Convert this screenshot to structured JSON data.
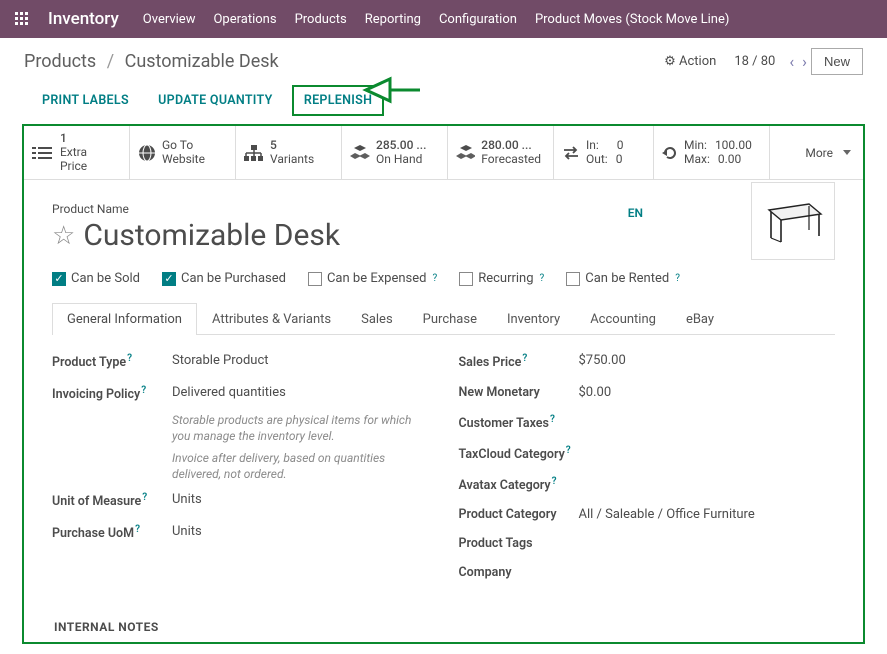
{
  "topnav": {
    "brand": "Inventory",
    "items": [
      "Overview",
      "Operations",
      "Products",
      "Reporting",
      "Configuration",
      "Product Moves (Stock Move Line)"
    ]
  },
  "subhead": {
    "root": "Products",
    "current": "Customizable Desk",
    "action": "Action",
    "pager": "18 / 80",
    "new_btn": "New"
  },
  "hdr_buttons": {
    "print": "PRINT LABELS",
    "update": "UPDATE QUANTITY",
    "replenish": "REPLENISH"
  },
  "stats": {
    "extra_price": {
      "num": "1",
      "label": "Extra Price"
    },
    "website": {
      "l1": "Go To",
      "l2": "Website"
    },
    "variants": {
      "num": "5",
      "label": "Variants"
    },
    "onhand": {
      "num": "285.00 ...",
      "label": "On Hand"
    },
    "forecast": {
      "num": "280.00 ...",
      "label": "Forecasted"
    },
    "inout": {
      "in_l": "In:",
      "in_v": "0",
      "out_l": "Out:",
      "out_v": "0"
    },
    "minmax": {
      "min_l": "Min:",
      "min_v": "100.00",
      "max_l": "Max:",
      "max_v": "0.00"
    },
    "more": "More"
  },
  "form": {
    "pname_label": "Product Name",
    "pname": "Customizable Desk",
    "lang": "EN",
    "checks": {
      "sold": "Can be Sold",
      "purchased": "Can be Purchased",
      "expensed": "Can be Expensed",
      "recurring": "Recurring",
      "rented": "Can be Rented"
    },
    "tabs": [
      "General Information",
      "Attributes & Variants",
      "Sales",
      "Purchase",
      "Inventory",
      "Accounting",
      "eBay"
    ],
    "left": {
      "ptype_l": "Product Type",
      "ptype_v": "Storable Product",
      "inv_l": "Invoicing Policy",
      "inv_v": "Delivered quantities",
      "hint1": "Storable products are physical items for which you manage the inventory level.",
      "hint2": "Invoice after delivery, based on quantities delivered, not ordered.",
      "uom_l": "Unit of Measure",
      "uom_v": "Units",
      "puom_l": "Purchase UoM",
      "puom_v": "Units"
    },
    "right": {
      "price_l": "Sales Price",
      "price_v": "$750.00",
      "mon_l": "New Monetary",
      "mon_v": "$0.00",
      "ctax_l": "Customer Taxes",
      "ctax_v": "",
      "tcloud_l": "TaxCloud Category",
      "tcloud_v": "",
      "avatax_l": "Avatax Category",
      "avatax_v": "",
      "pcat_l": "Product Category",
      "pcat_v": "All / Saleable / Office Furniture",
      "ptags_l": "Product Tags",
      "ptags_v": "",
      "comp_l": "Company",
      "comp_v": ""
    },
    "internal_notes": "INTERNAL NOTES"
  }
}
